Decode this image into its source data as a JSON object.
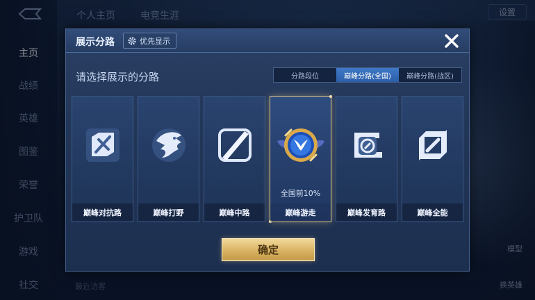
{
  "background": {
    "nav_items": [
      "主页",
      "战绩",
      "英雄",
      "图鉴",
      "荣誉",
      "护卫队",
      "游戏",
      "社交"
    ],
    "top_tabs": [
      "个人主页",
      "电竞生涯"
    ],
    "settings_label": "设置",
    "right_labels": [
      "模型",
      "换英雄"
    ],
    "recent_label": "最近访客"
  },
  "dialog": {
    "title": "展示分路",
    "pref_button": "优先显示",
    "prompt": "请选择展示的分路",
    "segments": [
      {
        "label": "分路段位",
        "active": false
      },
      {
        "label": "巅峰分路(全国)",
        "active": true
      },
      {
        "label": "巅峰分路(战区)",
        "active": false
      }
    ],
    "cards": [
      {
        "label": "巅峰对抗路",
        "icon": "clash-lane-icon",
        "sub": ""
      },
      {
        "label": "巅峰打野",
        "icon": "jungle-icon",
        "sub": ""
      },
      {
        "label": "巅峰中路",
        "icon": "mid-lane-icon",
        "sub": ""
      },
      {
        "label": "巅峰游走",
        "icon": "roam-icon",
        "sub": "全国前10%"
      },
      {
        "label": "巅峰发育路",
        "icon": "farm-lane-icon",
        "sub": ""
      },
      {
        "label": "巅峰全能",
        "icon": "all-round-icon",
        "sub": ""
      }
    ],
    "selected_index": 3,
    "confirm": "确定"
  },
  "colors": {
    "accent_gold": "#e8c98a",
    "segment_active": "#3f79c8",
    "dialog_bg": "#223658"
  }
}
